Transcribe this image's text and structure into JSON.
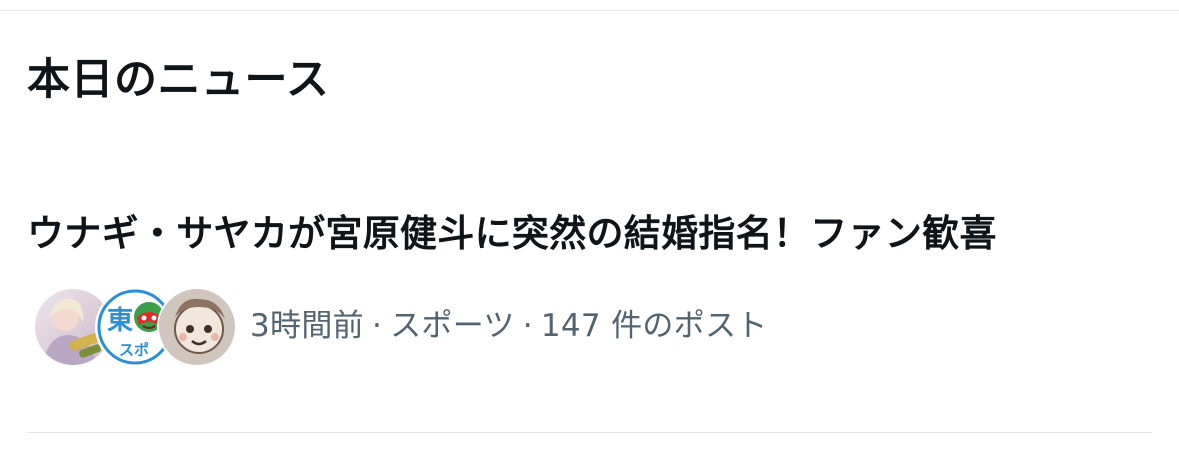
{
  "section": {
    "title": "本日のニュース"
  },
  "news": [
    {
      "headline": "ウナギ・サヤカが宮原健斗に突然の結婚指名！ファン歓喜",
      "time": "3時間前",
      "category": "スポーツ",
      "post_count": "147 件のポスト",
      "separator": "·",
      "avatars": [
        {
          "name": "avatar-photo-wrestler",
          "accent": "#d9c6d8"
        },
        {
          "name": "avatar-tospo-logo",
          "accent": "#2a8fd6",
          "text_top": "東",
          "text_bottom": "スポ"
        },
        {
          "name": "avatar-illustration",
          "accent": "#c8b7a8"
        }
      ]
    }
  ],
  "colors": {
    "text_primary": "#0f1419",
    "text_secondary": "#536471",
    "divider": "#e4e6e8",
    "logo_blue": "#2a8fd6",
    "logo_red": "#e02b2b",
    "logo_green": "#3aa14a"
  }
}
